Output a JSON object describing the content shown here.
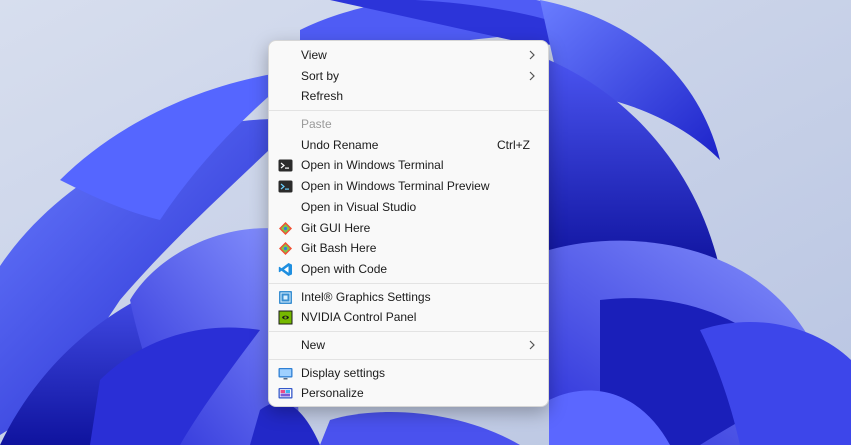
{
  "context_menu": {
    "items": [
      {
        "label": "View",
        "has_submenu": true
      },
      {
        "label": "Sort by",
        "has_submenu": true
      },
      {
        "label": "Refresh"
      },
      {
        "label": "Paste",
        "disabled": true
      },
      {
        "label": "Undo Rename",
        "shortcut": "Ctrl+Z"
      },
      {
        "label": "Open in Windows Terminal",
        "icon": "terminal-icon"
      },
      {
        "label": "Open in Windows Terminal Preview",
        "icon": "terminal-preview-icon"
      },
      {
        "label": "Open in Visual Studio"
      },
      {
        "label": "Git GUI Here",
        "icon": "git-gui-icon"
      },
      {
        "label": "Git Bash Here",
        "icon": "git-bash-icon"
      },
      {
        "label": "Open with Code",
        "icon": "vscode-icon"
      },
      {
        "label": "Intel® Graphics Settings",
        "icon": "intel-graphics-icon"
      },
      {
        "label": "NVIDIA Control Panel",
        "icon": "nvidia-icon"
      },
      {
        "label": "New",
        "has_submenu": true
      },
      {
        "label": "Display settings",
        "icon": "display-settings-icon"
      },
      {
        "label": "Personalize",
        "icon": "personalize-icon"
      }
    ]
  },
  "colors": {
    "menu_background": "#f9f9f9",
    "wallpaper_blue": "#3b3de0",
    "desktop_background": "#c9d3e8"
  }
}
